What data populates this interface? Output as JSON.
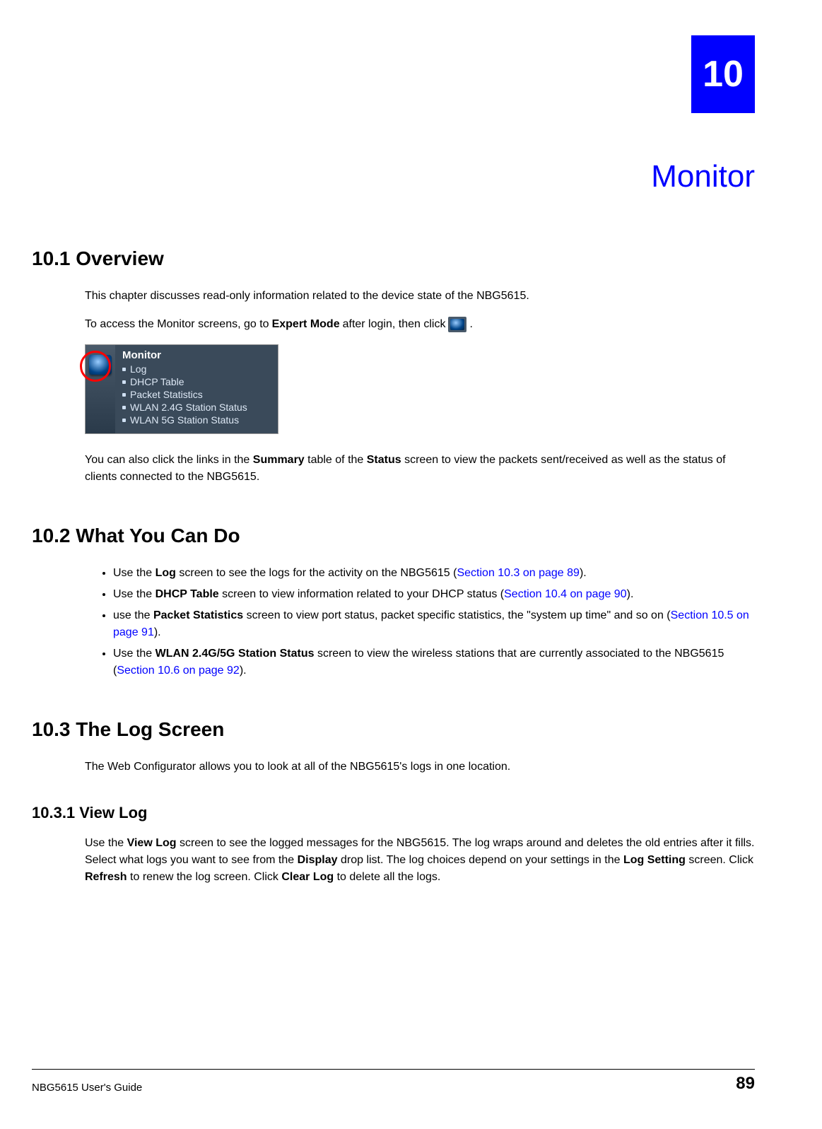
{
  "chapter": {
    "number": "10",
    "title": "Monitor"
  },
  "section1": {
    "heading": "10.1  Overview",
    "p1": "This chapter discusses read-only information related to the device state of the NBG5615.",
    "p2_a": "To access the Monitor screens, go to ",
    "p2_b": "Expert Mode",
    "p2_c": " after login, then click ",
    "p2_d": ".",
    "p3_a": "You can also click the links in the ",
    "p3_b": "Summary",
    "p3_c": " table of the ",
    "p3_d": "Status",
    "p3_e": " screen to view the packets sent/received as well as the status of clients connected to the NBG5615."
  },
  "menu": {
    "header": "Monitor",
    "items": [
      "Log",
      "DHCP Table",
      "Packet Statistics",
      "WLAN 2.4G Station Status",
      "WLAN 5G Station Status"
    ]
  },
  "section2": {
    "heading": "10.2  What You Can Do",
    "b1_a": "Use the ",
    "b1_b": "Log",
    "b1_c": " screen to see the logs for the activity on the NBG5615 (",
    "b1_link": "Section 10.3 on page 89",
    "b1_d": ").",
    "b2_a": "Use the ",
    "b2_b": "DHCP Table",
    "b2_c": " screen to view information related to your DHCP status (",
    "b2_link": "Section 10.4 on page 90",
    "b2_d": ").",
    "b3_a": "use the ",
    "b3_b": "Packet Statistics",
    "b3_c": " screen to view port status, packet specific statistics, the \"system up time\" and so on (",
    "b3_link": "Section 10.5 on page 91",
    "b3_d": ").",
    "b4_a": "Use the ",
    "b4_b": "WLAN 2.4G/5G Station Status",
    "b4_c": " screen to view the wireless stations that are currently associated to the NBG5615 (",
    "b4_link": "Section 10.6 on page 92",
    "b4_d": ")."
  },
  "section3": {
    "heading": "10.3  The Log Screen",
    "p1": "The Web Configurator allows you to look at all of the NBG5615's logs in one location."
  },
  "section31": {
    "heading": "10.3.1  View Log",
    "p_a": "Use the ",
    "p_b": "View Log",
    "p_c": " screen to see the logged messages for the NBG5615. The log wraps around and deletes the old entries after it fills. Select what logs you want to see from the ",
    "p_d": "Display",
    "p_e": " drop list. The log choices depend on your settings in the ",
    "p_f": "Log Setting",
    "p_g": " screen. Click ",
    "p_h": "Refresh",
    "p_i": " to renew the log screen. Click ",
    "p_j": "Clear Log",
    "p_k": " to delete all the logs."
  },
  "footer": {
    "guide": "NBG5615 User's Guide",
    "page": "89"
  }
}
